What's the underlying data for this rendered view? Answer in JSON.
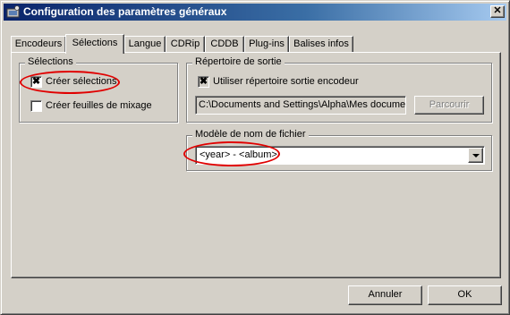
{
  "window": {
    "title": "Configuration des paramètres généraux",
    "close_glyph": "✕"
  },
  "tabs": [
    {
      "label": "Encodeurs",
      "active": false
    },
    {
      "label": "Sélections",
      "active": true
    },
    {
      "label": "Langue",
      "active": false
    },
    {
      "label": "CDRip",
      "active": false
    },
    {
      "label": "CDDB",
      "active": false
    },
    {
      "label": "Plug-ins",
      "active": false
    },
    {
      "label": "Balises infos",
      "active": false
    }
  ],
  "selections_group": {
    "legend": "Sélections",
    "create_selections": {
      "label": "Créer sélections",
      "checked": true,
      "mark": "✖"
    },
    "create_mix_sheets": {
      "label": "Créer feuilles de mixage",
      "checked": false,
      "mark": ""
    }
  },
  "output_group": {
    "legend": "Répertoire de sortie",
    "use_encoder_dir": {
      "label": "Utiliser répertoire sortie encodeur",
      "checked": true,
      "mark": "✖"
    },
    "path_value": "C:\\Documents and Settings\\Alpha\\Mes docume",
    "browse_label": "Parcourir"
  },
  "filename_group": {
    "legend": "Modèle de nom de fichier",
    "pattern_value": "<year> - <album>"
  },
  "footer": {
    "cancel_label": "Annuler",
    "ok_label": "OK"
  },
  "colors": {
    "title_gradient_start": "#0a246a",
    "title_gradient_end": "#a6caf0",
    "annotation": "#e00000",
    "face": "#d4d0c8"
  }
}
